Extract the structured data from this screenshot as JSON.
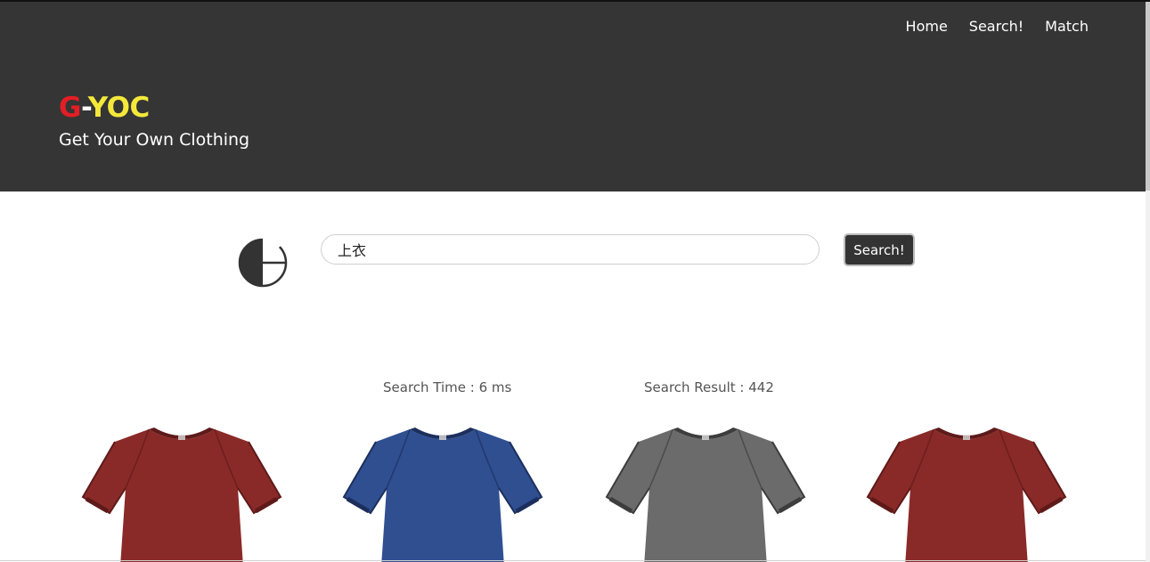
{
  "nav": {
    "home": "Home",
    "search": "Search!",
    "match": "Match"
  },
  "brand": {
    "g": "G",
    "dash": "-",
    "yoc": "YOC",
    "tagline": "Get Your Own Clothing"
  },
  "search": {
    "value": "上衣",
    "button_label": "Search!"
  },
  "stats": {
    "time": "Search Time : 6 ms",
    "result": "Search Result : 442"
  },
  "products": [
    {
      "color": "#8a2a28",
      "shade": "#5e1a19",
      "name": "red-tshirt"
    },
    {
      "color": "#2f4f91",
      "shade": "#1c2f5c",
      "name": "blue-tshirt"
    },
    {
      "color": "#6b6b6b",
      "shade": "#3d3d3d",
      "name": "gray-tshirt"
    },
    {
      "color": "#8a2a28",
      "shade": "#5e1a19",
      "name": "red-tshirt"
    }
  ],
  "colors": {
    "header_bg": "#353535",
    "brand_red": "#e31e24",
    "brand_yellow": "#f4e83a",
    "button_bg": "#333333"
  }
}
